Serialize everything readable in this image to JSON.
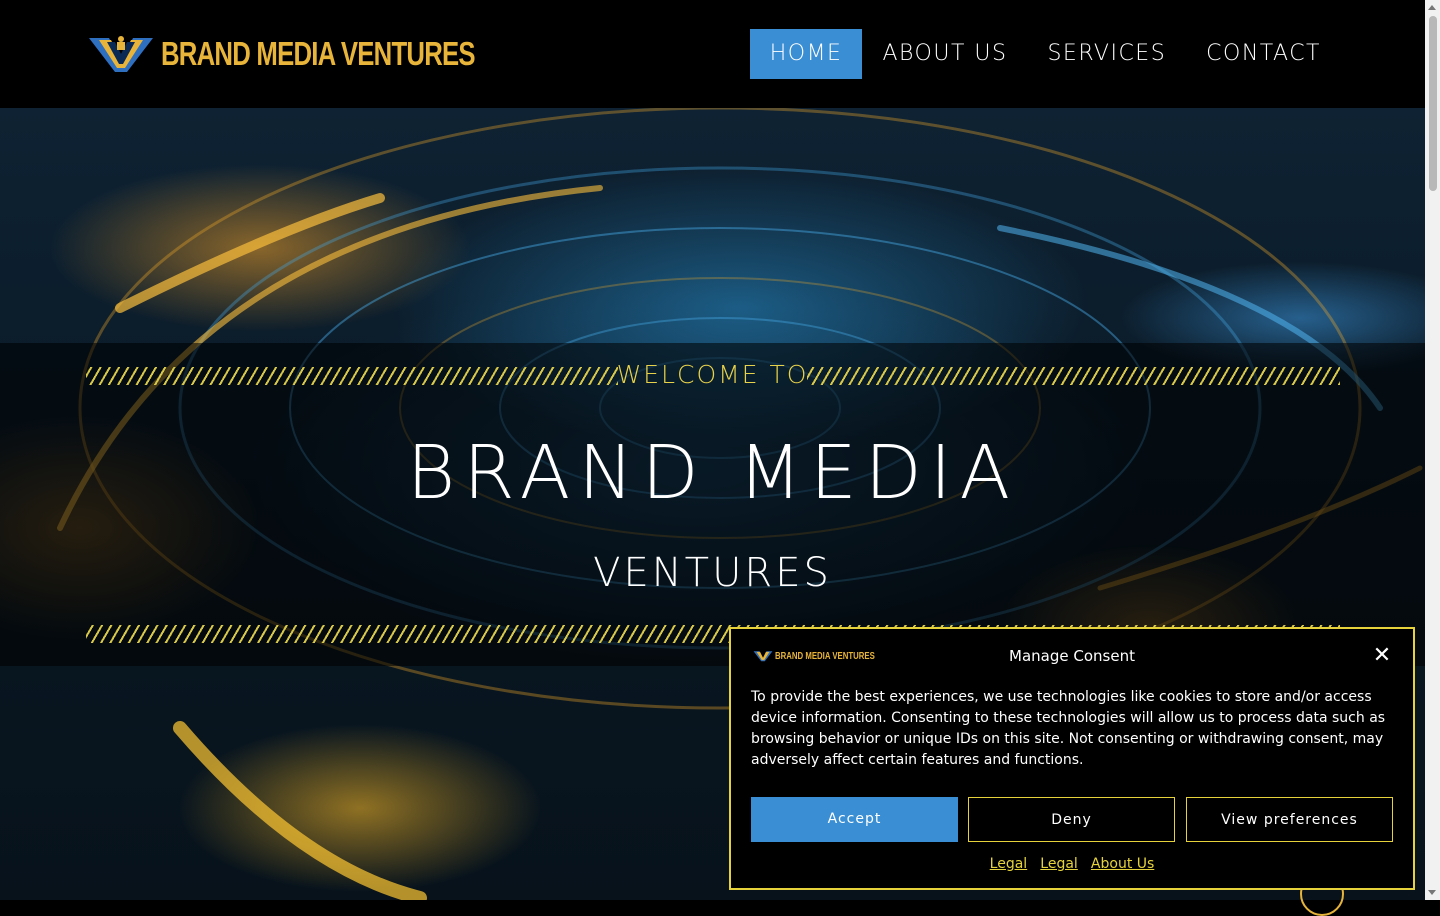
{
  "brand": {
    "name": "BRAND MEDIA VENTURES",
    "logo_icon": "bmv-v-logo-icon"
  },
  "nav": {
    "items": [
      {
        "label": "HOME",
        "active": true
      },
      {
        "label": "ABOUT US",
        "active": false
      },
      {
        "label": "SERVICES",
        "active": false
      },
      {
        "label": "CONTACT",
        "active": false
      }
    ]
  },
  "hero": {
    "welcome": "WELCOME TO",
    "title": "BRAND MEDIA",
    "subtitle": "VENTURES"
  },
  "consent": {
    "logo_text": "BRAND MEDIA VENTURES",
    "title": "Manage Consent",
    "close_icon": "close-icon",
    "body": "To provide the best experiences, we use technologies like cookies to store and/or access device information. Consenting to these technologies will allow us to process data such as browsing behavior or unique IDs on this site. Not consenting or withdrawing consent, may adversely affect certain features and functions.",
    "accept_label": "Accept",
    "deny_label": "Deny",
    "prefs_label": "View preferences",
    "links": [
      "Legal",
      "Legal",
      "About Us"
    ]
  },
  "colors": {
    "accent_blue": "#3a8ed4",
    "gold": "#e8b53a",
    "yellow_border": "#e6d33c"
  }
}
